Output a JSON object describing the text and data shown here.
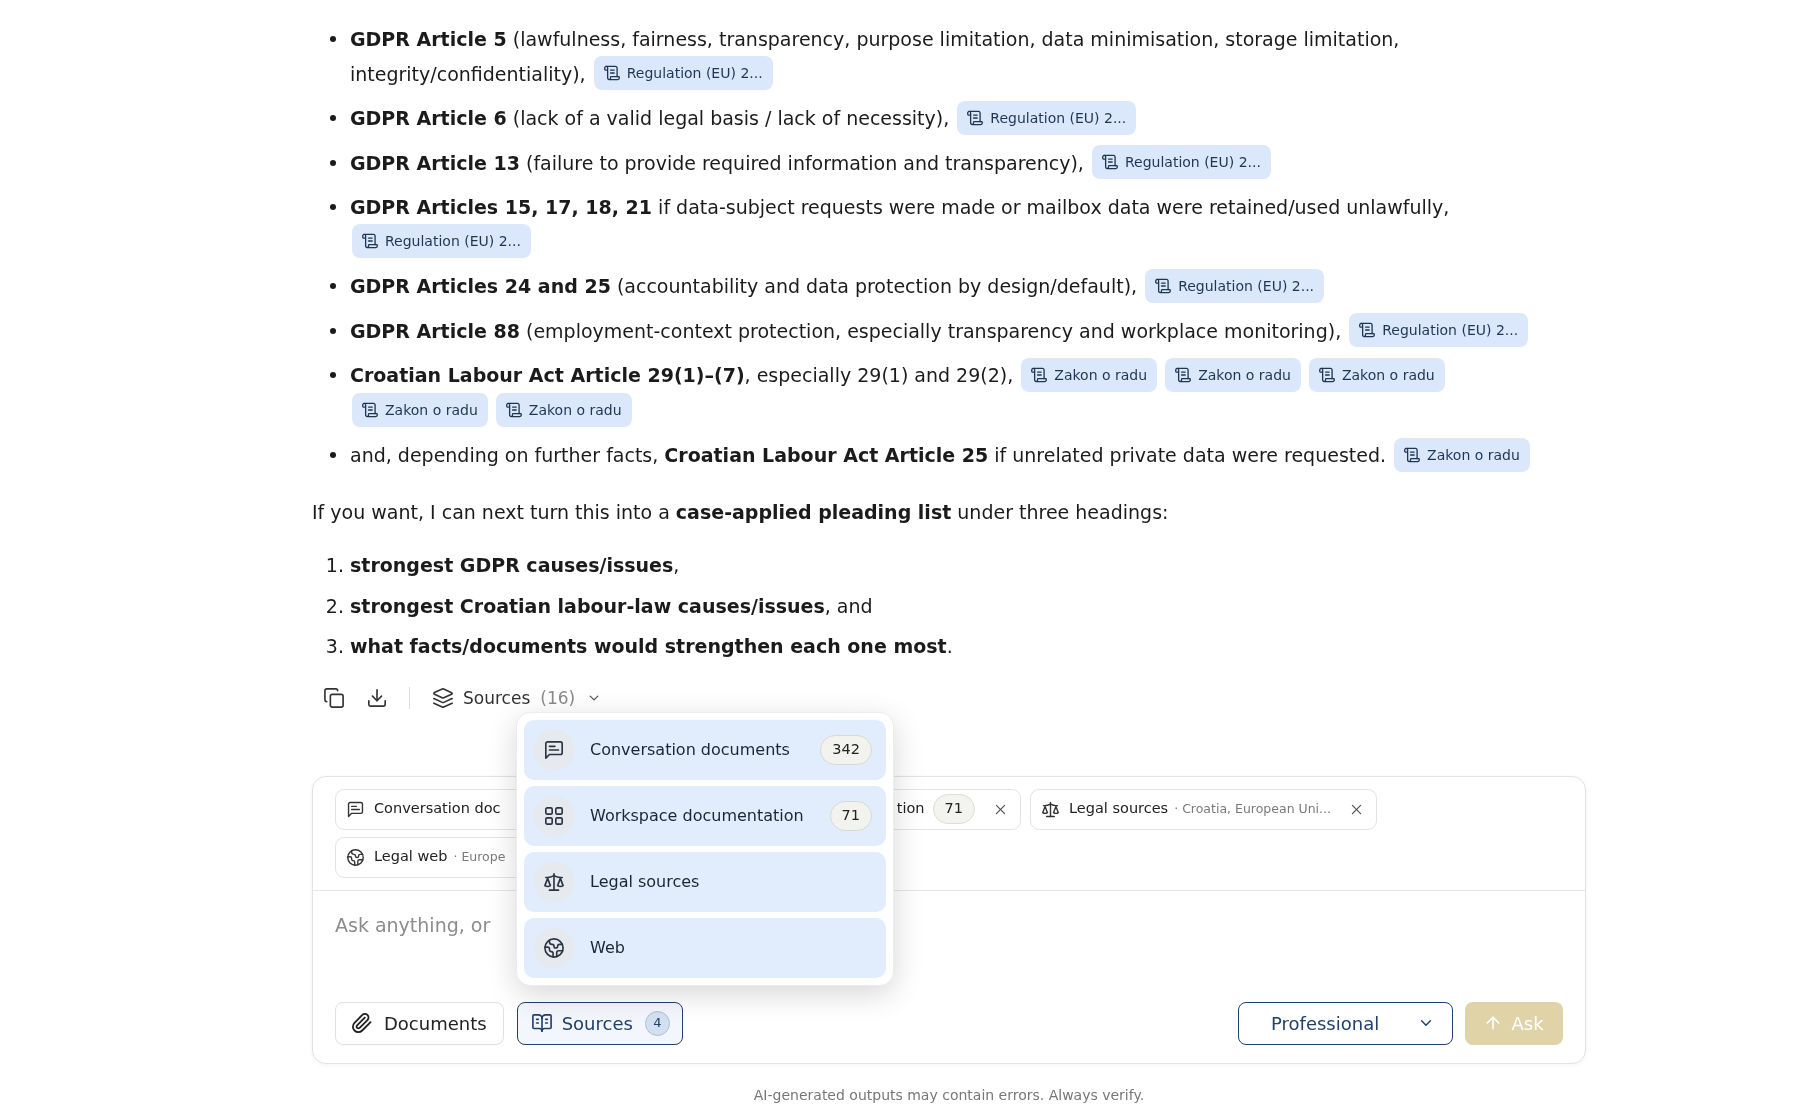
{
  "answer": {
    "bullets": [
      {
        "text": "**GDPR Article 5** (lawfulness, fairness, transparency, purpose limitation, data minimisation, storage limitation, integrity/confidentiality),",
        "citations": [
          "Regulation (EU) 2..."
        ]
      },
      {
        "text": "**GDPR Article 6** (lack of a valid legal basis / lack of necessity),",
        "citations": [
          "Regulation (EU) 2..."
        ]
      },
      {
        "text": "**GDPR Article 13** (failure to provide required information and transparency),",
        "citations": [
          "Regulation (EU) 2..."
        ]
      },
      {
        "text": "**GDPR Articles 15, 17, 18, 21** if data-subject requests were made or mailbox data were retained/used unlawfully,",
        "citations": [
          "Regulation (EU) 2..."
        ]
      },
      {
        "text": "**GDPR Articles 24 and 25** (accountability and data protection by design/default),",
        "citations": [
          "Regulation (EU) 2..."
        ]
      },
      {
        "text": "**GDPR Article 88** (employment-context protection, especially transparency and workplace monitoring),",
        "citations": [
          "Regulation (EU) 2..."
        ]
      },
      {
        "text": "**Croatian Labour Act Article 29(1)–(7)**, especially 29(1) and 29(2),",
        "citations": [
          "Zakon o radu",
          "Zakon o radu",
          "Zakon o radu",
          "Zakon o radu",
          "Zakon o radu"
        ]
      },
      {
        "text": "and, depending on further facts, **Croatian Labour Act Article 25** if unrelated private data were requested.",
        "citations": [
          "Zakon o radu"
        ]
      }
    ],
    "outro": "If you want, I can next turn this into a **case-applied pleading list** under three headings:",
    "numbered": [
      {
        "number": "1.",
        "text": "**strongest GDPR causes/issues**,"
      },
      {
        "number": "2.",
        "text": "**strongest Croatian labour-law causes/issues**, and"
      },
      {
        "number": "3.",
        "text": "**what facts/documents would strengthen each one most**."
      }
    ]
  },
  "message_toolbar": {
    "sources_label": "Sources",
    "sources_count": "(16)"
  },
  "sources_menu": {
    "items": [
      {
        "kind": "conversation",
        "label": "Conversation documents",
        "count": "342",
        "selected": true
      },
      {
        "kind": "workspace",
        "label": "Workspace documentation",
        "count": "71",
        "selected": true
      },
      {
        "kind": "legal",
        "label": "Legal sources",
        "selected": true
      },
      {
        "kind": "web",
        "label": "Web",
        "selected": true
      }
    ]
  },
  "composer": {
    "chips": [
      {
        "kind": "conversation",
        "label": "Conversation doc"
      },
      {
        "label": "tion",
        "count": "71",
        "removable": true
      },
      {
        "kind": "legal",
        "label": "Legal sources",
        "detail": "· Croatia, European Uni...",
        "removable": true
      },
      {
        "kind": "web",
        "label": "Legal web",
        "detail": "· Europe"
      }
    ],
    "placeholder": "Ask anything, or",
    "documents_button": "Documents",
    "sources_button": {
      "label": "Sources",
      "count": "4",
      "selected": true
    },
    "mode_select": "Professional",
    "ask_button": {
      "label": "Ask",
      "disabled": true
    }
  },
  "footer": "AI-generated outputs may contain errors. Always verify."
}
